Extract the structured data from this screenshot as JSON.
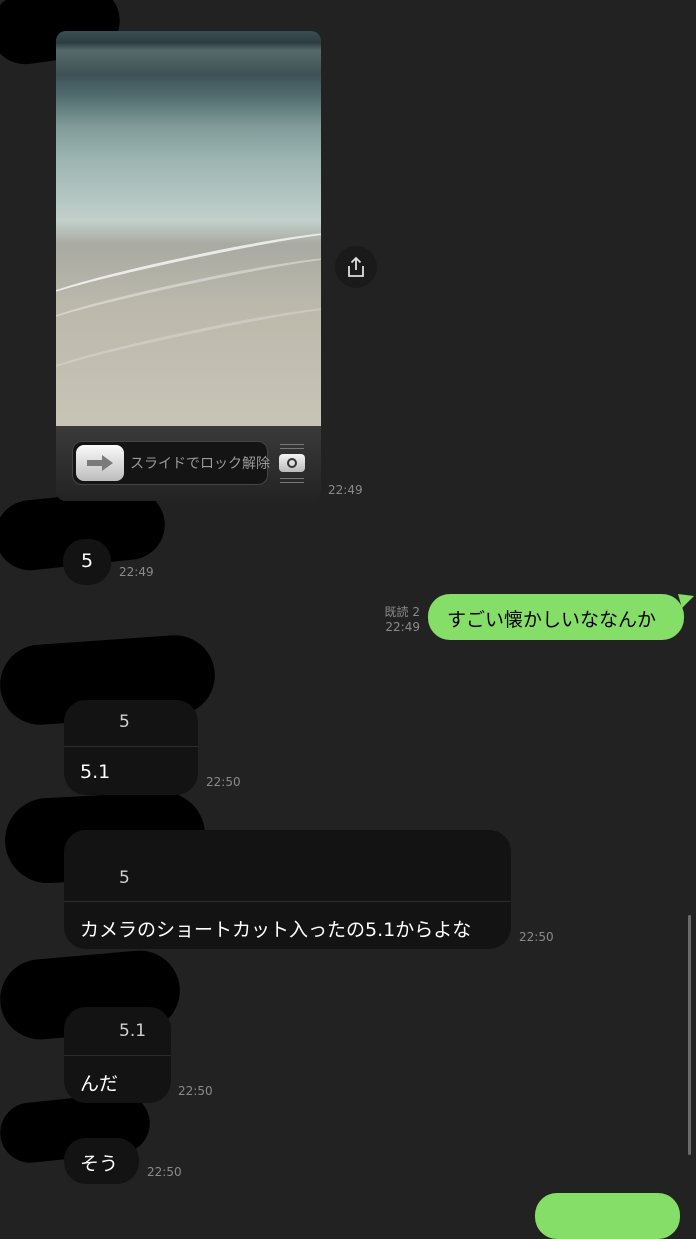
{
  "messages": {
    "image_msg": {
      "lock_slider_label": "スライドでロック解除",
      "time": "22:49"
    },
    "msg_5": {
      "text": "5",
      "time": "22:49"
    },
    "sent_1": {
      "read": "既読 2",
      "time": "22:49",
      "text": "すごい懐かしいななんか"
    },
    "reply_1": {
      "quote": "5",
      "text": "5.1",
      "time": "22:50"
    },
    "reply_2": {
      "quote": "5",
      "text": "カメラのショートカット入ったの5.1からよな",
      "time": "22:50"
    },
    "reply_3": {
      "quote": "5.1",
      "text": "んだ",
      "time": "22:50"
    },
    "msg_last": {
      "text": "そう",
      "time": "22:50"
    }
  },
  "colors": {
    "background": "#222222",
    "incoming_bubble": "#131313",
    "outgoing_bubble": "#85de68"
  },
  "icons": [
    "share-icon",
    "arrow-right-icon",
    "camera-icon"
  ]
}
